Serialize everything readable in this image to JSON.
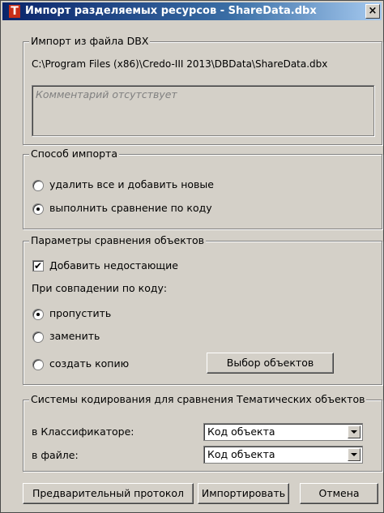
{
  "window": {
    "title": "Импорт разделяемых ресурсов - ShareData.dbx",
    "icon_letter": "T",
    "close_symbol": "×"
  },
  "import_file": {
    "group_title": "Импорт из файла DBX",
    "path": "C:\\Program Files (x86)\\Credo-III 2013\\DBData\\ShareData.dbx",
    "comment": "Комментарий отсутствует"
  },
  "import_method": {
    "group_title": "Способ импорта",
    "options": [
      {
        "label": "удалить все и добавить новые",
        "checked": false
      },
      {
        "label": "выполнить сравнение по коду",
        "checked": true
      }
    ]
  },
  "compare_params": {
    "group_title": "Параметры сравнения объектов",
    "add_missing": {
      "label": "Добавить недостающие",
      "checked": true
    },
    "on_match_label": "При совпадении по коду:",
    "options": [
      {
        "label": "пропустить",
        "checked": true
      },
      {
        "label": "заменить",
        "checked": false
      },
      {
        "label": "создать копию",
        "checked": false
      }
    ],
    "select_objects_button": "Выбор объектов"
  },
  "coding_systems": {
    "group_title": "Системы кодирования для сравнения Тематических объектов",
    "classifier_label": "в Классификаторе:",
    "classifier_value": "Код объекта",
    "file_label": "в файле:",
    "file_value": "Код объекта"
  },
  "buttons": {
    "preview": "Предварительный протокол",
    "import": "Импортировать",
    "cancel": "Отмена"
  },
  "colors": {
    "window_bg": "#d4d0c8",
    "title_gradient_start": "#0a246a",
    "app_icon": "#c82e18"
  }
}
